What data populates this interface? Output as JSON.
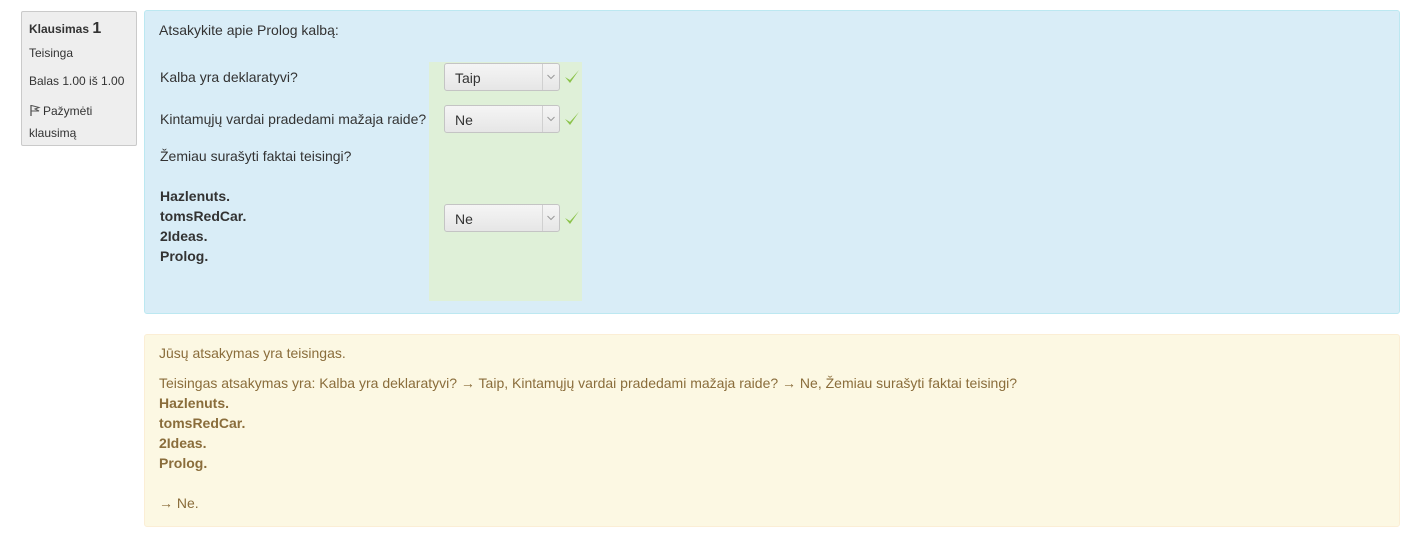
{
  "info": {
    "question_label": "Klausimas",
    "question_number": "1",
    "state": "Teisinga",
    "grade": "Balas 1.00 iš 1.00",
    "flag_label_line1": "Pažymėti",
    "flag_label_line2": "klausimą"
  },
  "question": {
    "text": "Atsakykite apie Prolog kalbą:",
    "rows": [
      {
        "prompt": "Kalba yra deklaratyvi?",
        "selected": "Taip"
      },
      {
        "prompt": "Kintamųjų vardai pradedami mažaja raide?",
        "selected": "Ne"
      },
      {
        "prompt": "Žemiau surašyti faktai teisingi?",
        "selected": "Ne"
      }
    ],
    "facts": [
      "Hazlenuts.",
      "tomsRedCar.",
      "2Ideas.",
      "Prolog."
    ]
  },
  "outcome": {
    "feedback": "Jūsų atsakymas yra teisingas.",
    "right_answer_intro": "Teisingas atsakymas yra: Kalba yra deklaratyvi? → Taip, Kintamųjų vardai pradedami mažaja raide? → Ne, Žemiau surašyti faktai teisingi?",
    "facts": [
      "Hazlenuts.",
      "tomsRedCar.",
      "2Ideas.",
      "Prolog."
    ],
    "final": "→ Ne."
  },
  "colors": {
    "info_bg": "#eeeeee",
    "formulation_bg": "#d9edf7",
    "correct_bg": "#dff0d8",
    "outcome_bg": "#fcf8e3",
    "outcome_text": "#8a6d3b",
    "check": "#8bc34a"
  },
  "icons": {
    "flag": "flag-icon",
    "check": "check-icon",
    "caret": "chevron-down-icon"
  }
}
